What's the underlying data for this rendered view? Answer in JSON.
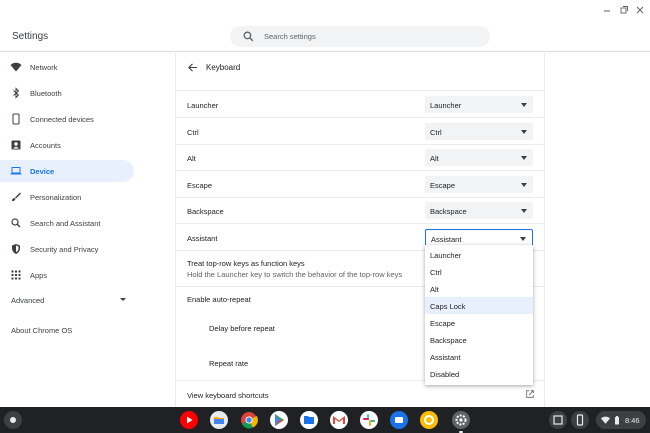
{
  "window": {
    "title": "Settings"
  },
  "search": {
    "placeholder": "Search settings"
  },
  "sidebar": {
    "items": [
      {
        "label": "Network",
        "icon": "wifi-icon"
      },
      {
        "label": "Bluetooth",
        "icon": "bluetooth-icon"
      },
      {
        "label": "Connected devices",
        "icon": "phone-icon"
      },
      {
        "label": "Accounts",
        "icon": "person-icon"
      },
      {
        "label": "Device",
        "icon": "laptop-icon",
        "active": true
      },
      {
        "label": "Personalization",
        "icon": "brush-icon"
      },
      {
        "label": "Search and Assistant",
        "icon": "search-icon"
      },
      {
        "label": "Security and Privacy",
        "icon": "shield-icon"
      },
      {
        "label": "Apps",
        "icon": "apps-grid-icon"
      }
    ],
    "advanced": "Advanced",
    "about": "About Chrome OS"
  },
  "page": {
    "title": "Keyboard",
    "rows": [
      {
        "label": "Launcher",
        "value": "Launcher"
      },
      {
        "label": "Ctrl",
        "value": "Ctrl"
      },
      {
        "label": "Alt",
        "value": "Alt"
      },
      {
        "label": "Escape",
        "value": "Escape"
      },
      {
        "label": "Backspace",
        "value": "Backspace"
      },
      {
        "label": "Assistant",
        "value": "Assistant"
      }
    ],
    "function_keys": {
      "label": "Treat top-row keys as function keys",
      "sublabel": "Hold the Launcher key to switch the behavior of the top-row keys"
    },
    "auto_repeat": "Enable auto-repeat",
    "delay_before_repeat": "Delay before repeat",
    "repeat_rate": "Repeat rate",
    "shortcuts": "View keyboard shortcuts"
  },
  "dropdown": {
    "options": [
      "Launcher",
      "Ctrl",
      "Alt",
      "Caps Lock",
      "Escape",
      "Backspace",
      "Assistant",
      "Disabled"
    ],
    "highlighted": "Caps Lock"
  },
  "shelf": {
    "apps": [
      "youtube-icon",
      "files-folder-icon",
      "chrome-icon",
      "play-store-icon",
      "files-icon",
      "gmail-icon",
      "slack-icon",
      "messages-icon",
      "clipboard-app-icon",
      "settings-icon"
    ],
    "time": "8:46"
  },
  "colors": {
    "accent": "#1a73e8",
    "active_bg": "#e8f0fe",
    "shelf": "#202124"
  }
}
